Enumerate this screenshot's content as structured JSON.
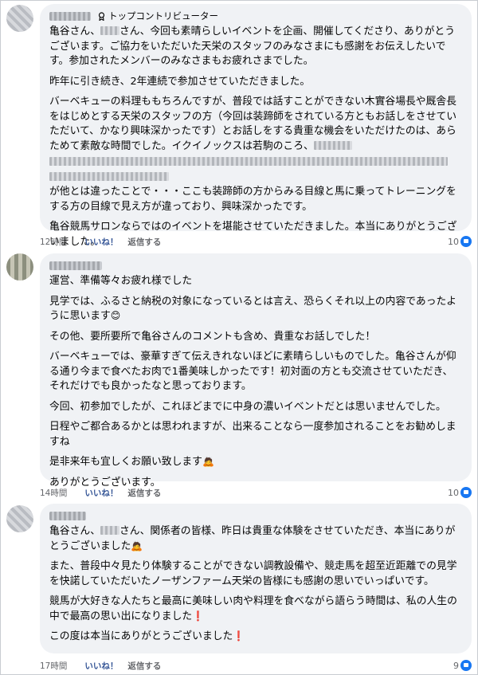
{
  "comments": [
    {
      "badge": "トップコントリビューター",
      "paragraphs": [
        [
          "亀谷さん、",
          "@blur",
          "さん、今回も素晴らしいイベントを企画、開催してくださり、ありがとうございます。ご協力をいただいた天栄のスタッフのみなさまにも感謝をお伝えしたいです。参加されたメンバーのみなさまもお疲れさまでした。"
        ],
        [
          "昨年に引き続き、2年連続で参加させていただきました。"
        ],
        [
          "バーベキューの料理ももちろんですが、普段では話すことができない木實谷場長や厩舎長をはじめとする天栄のスタッフの方（今回は装蹄師をされている方ともお話しをさせていただいて、かなり興味深かったです）とお話しをする貴重な機会をいただけたのは、あらためて素敵な時間でした。イクイノックスは若駒のころ、",
          "@blur"
        ],
        [
          "が他とは違ったことで・・・ここも装蹄師の方からみる目線と馬に乗ってトレーニングをする方の目線で見え方が違っており、興味深かったです。"
        ],
        [
          "亀谷競馬サロンならではのイベントを堪能させていただきました。本当にありがとうございました。"
        ]
      ],
      "time": "12時間",
      "like": "いいね！",
      "reply": "返信する",
      "reactions": "10"
    },
    {
      "badge": "",
      "paragraphs": [
        [
          "運営、準備等々お疲れ様でした"
        ],
        [
          "見学では、ふるさと納税の対象になっているとは言え、恐らくそれ以上の内容であったように思います",
          "@emoji:smile"
        ],
        [
          "その他、要所要所で亀谷さんのコメントも含め、貴重なお話しでした！"
        ],
        [
          "バーベキューでは、豪華すぎて伝えきれないほどに素晴らしいものでした。亀谷さんが仰る通り今まで食べたお肉で1番美味しかったです！初対面の方とも交流させていただき、それだけでも良かったなと思っております。"
        ],
        [
          "今回、初参加でしたが、これほどまでに中身の濃いイベントだとは思いませんでした。"
        ],
        [
          "日程やご都合あるかとは思われますが、出来ることなら一度参加されることをお勧めしますね"
        ],
        [
          "是非来年も宜しくお願い致します",
          "@emoji:bow"
        ],
        [
          "ありがとうございます。"
        ]
      ],
      "time": "14時間",
      "like": "いいね！",
      "reply": "返信する",
      "reactions": "10"
    },
    {
      "badge": "",
      "paragraphs": [
        [
          "亀谷さん、",
          "@blur",
          "さん、関係者の皆様、昨日は貴重な体験をさせていただき、本当にありがとうございました",
          "@emoji:bow"
        ],
        [
          "また、普段中々見たり体験することができない調教設備や、競走馬を超至近距離での見学を快諾していただいたノーザンファーム天栄の皆様にも感謝の思いでいっぱいです。"
        ],
        [
          "競馬が大好きな人たちと最高に美味しい肉や料理を食べながら語らう時間は、私の人生の中で最高の思い出になりました",
          "@emoji:excl"
        ],
        [
          "この度は本当にありがとうございました",
          "@emoji:excl"
        ]
      ],
      "time": "17時間",
      "like": "いいね！",
      "reply": "返信する",
      "reactions": "9"
    }
  ],
  "colors": {
    "bubble": "#f0f2f5",
    "like": "#385898",
    "meta": "#65676b",
    "reaction": "#1877f2"
  }
}
